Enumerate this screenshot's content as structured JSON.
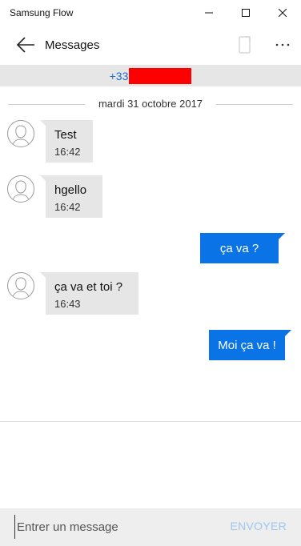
{
  "window": {
    "title": "Samsung Flow"
  },
  "header": {
    "title": "Messages"
  },
  "contact": {
    "number_prefix": "+33"
  },
  "conversation": {
    "date": "mardi 31 octobre 2017",
    "messages": [
      {
        "direction": "in",
        "text": "Test",
        "time": "16:42"
      },
      {
        "direction": "in",
        "text": "hgello",
        "time": "16:42"
      },
      {
        "direction": "out",
        "text": "ça va ?"
      },
      {
        "direction": "in",
        "text": "ça va et toi ?",
        "time": "16:43"
      },
      {
        "direction": "out",
        "text": "Moi ça va !"
      }
    ]
  },
  "compose": {
    "placeholder": "Entrer un message",
    "send_label": "ENVOYER"
  },
  "colors": {
    "outgoing_bubble": "#0a74e6",
    "incoming_bubble": "#e6e6e6",
    "contact_number": "#1a6ec8",
    "send_disabled": "#9fc6ef"
  }
}
